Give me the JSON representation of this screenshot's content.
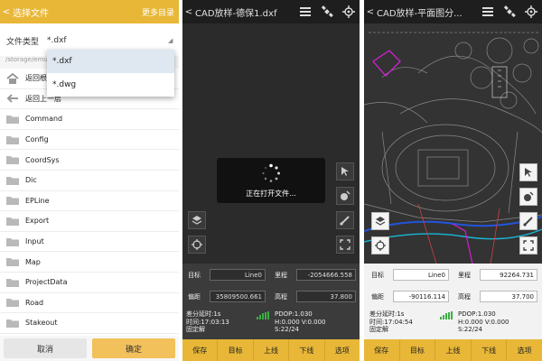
{
  "screen1": {
    "title": "选择文件",
    "more": "更多目录",
    "file_type_label": "文件类型",
    "file_type_value": "*.dxf",
    "path": "/storage/emu",
    "dropdown": [
      "*.dxf",
      "*.dwg"
    ],
    "nav_root": "返回根",
    "nav_up": "返回上一层",
    "folders": [
      "Command",
      "Config",
      "CoordSys",
      "Dic",
      "EPLine",
      "Export",
      "Input",
      "Map",
      "ProjectData",
      "Road",
      "Stakeout"
    ],
    "cancel": "取消",
    "ok": "确定"
  },
  "screen2": {
    "title": "CAD放样-德保1.dxf",
    "loading": "正在打开文件...",
    "target_label": "目标",
    "target_value": "Line0",
    "mileage_label": "里程",
    "mileage_value": "-2054666.558",
    "offset_label": "偏距",
    "offset_value": "35809500.661",
    "elev_label": "高程",
    "elev_value": "37.800",
    "diff_delay": "差分延时:1s",
    "time": "时间:17:03:13",
    "fix": "固定解",
    "pdop": "PDOP:1.030",
    "hv": "H:0.000  V:0.000",
    "sats": "S:22/24",
    "buttons": [
      "保存",
      "目标",
      "上线",
      "下线",
      "选项"
    ]
  },
  "screen3": {
    "title": "CAD放样-平面图分...",
    "target_label": "目标",
    "target_value": "Line0",
    "mileage_label": "里程",
    "mileage_value": "92264.731",
    "offset_label": "偏距",
    "offset_value": "-90116.114",
    "elev_label": "高程",
    "elev_value": "37.700",
    "diff_delay": "差分延时:1s",
    "time": "时间:17:04:54",
    "fix": "固定解",
    "pdop": "PDOP:1.030",
    "hv": "H:0.000  V:0.000",
    "sats": "S:22/24",
    "buttons": [
      "保存",
      "目标",
      "上线",
      "下线",
      "选项"
    ]
  },
  "colors": {
    "accent": "#e8b737",
    "dark_bg": "#2b2b2b",
    "magenta": "#d020d0",
    "blue": "#2255dd",
    "cyan": "#19b6d6",
    "green": "#3cb043"
  },
  "icons": [
    "back-arrow-icon",
    "menu-icon",
    "satellite-icon",
    "gps-crosshair-icon",
    "dropdown-caret-icon",
    "home-icon",
    "up-arrow-icon",
    "folder-icon",
    "cursor-icon",
    "point-icon",
    "brush-icon",
    "fullscreen-icon",
    "layers-icon",
    "target-icon",
    "signal-icon"
  ]
}
